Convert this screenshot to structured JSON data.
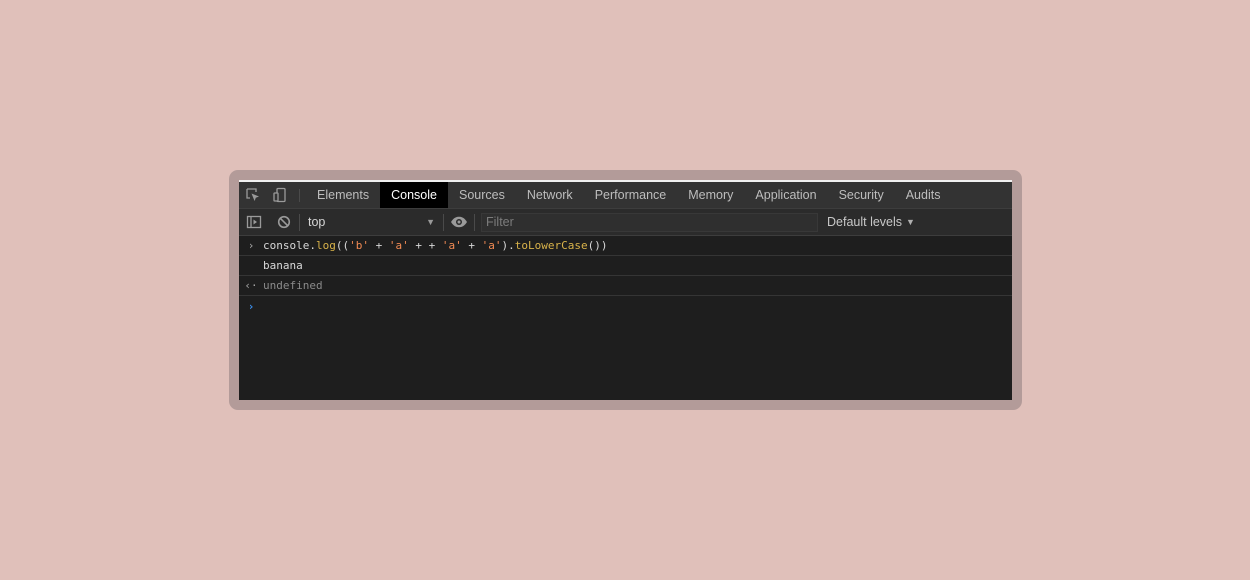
{
  "tabs": [
    {
      "label": "Elements",
      "active": false
    },
    {
      "label": "Console",
      "active": true
    },
    {
      "label": "Sources",
      "active": false
    },
    {
      "label": "Network",
      "active": false
    },
    {
      "label": "Performance",
      "active": false
    },
    {
      "label": "Memory",
      "active": false
    },
    {
      "label": "Application",
      "active": false
    },
    {
      "label": "Security",
      "active": false
    },
    {
      "label": "Audits",
      "active": false
    }
  ],
  "toolbar": {
    "context": "top",
    "filter_placeholder": "Filter",
    "filter_value": "",
    "levels_label": "Default levels"
  },
  "console": {
    "input_segments": {
      "s0": "console.",
      "s1": "log",
      "s2": "((",
      "s3": "'b'",
      "s4": " + ",
      "s5": "'a'",
      "s6": " + + ",
      "s7": "'a'",
      "s8": " + ",
      "s9": "'a'",
      "s10": ").",
      "s11": "toLowerCase",
      "s12": "())"
    },
    "log_output": "banana",
    "return_value": "undefined"
  },
  "colors": {
    "background": "#e0c0ba",
    "frame": "#b39b99",
    "active_tab": "#000000",
    "string_token": "#f28b54",
    "function_token": "#d9b34a",
    "prompt": "#3b8eea"
  }
}
